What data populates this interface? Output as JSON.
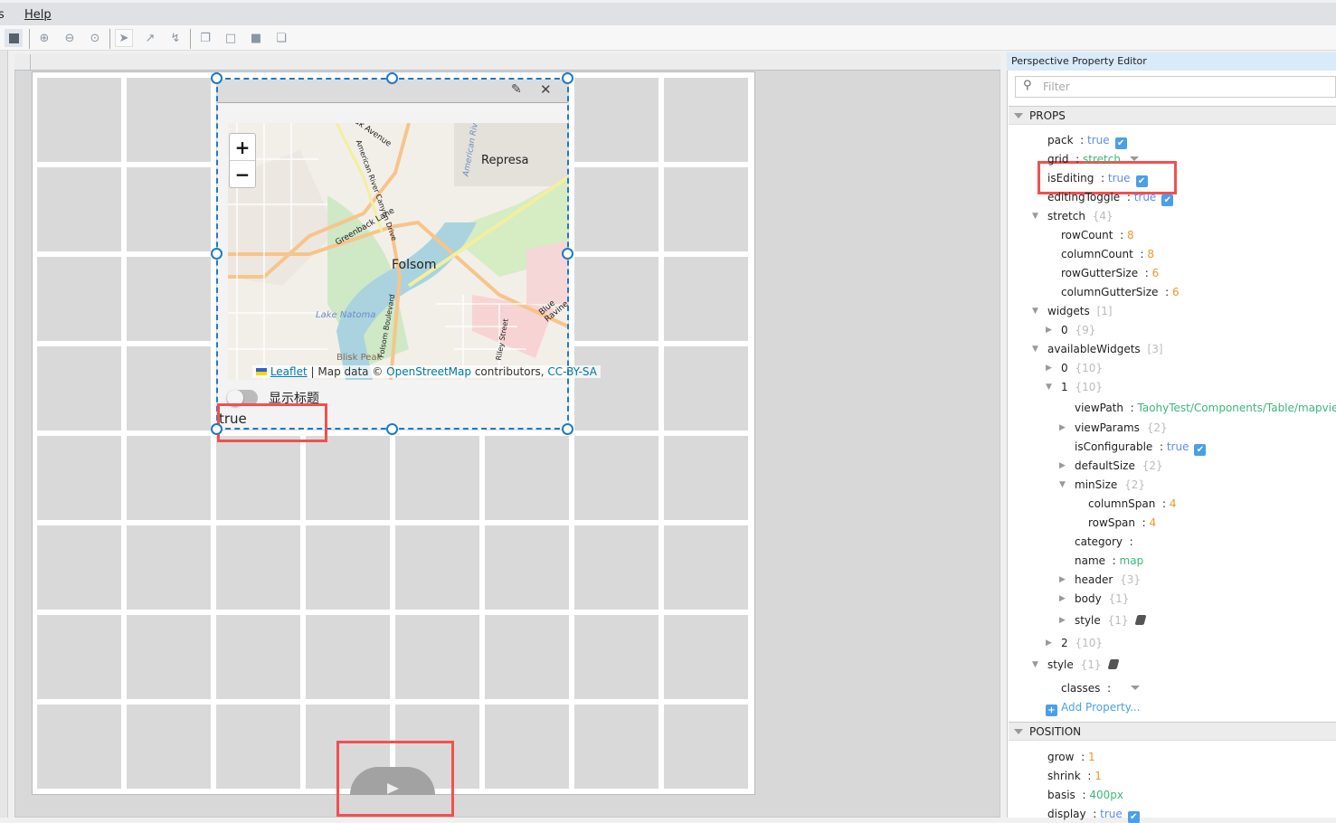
{
  "menubar": {
    "cut_item": "s",
    "help": "Help"
  },
  "toolbar": {
    "icons": [
      "stop-icon",
      "zoom-in-icon",
      "zoom-out-icon",
      "zoom-fit-icon",
      "select-arrow-icon",
      "connect-icon",
      "reroute-icon",
      "bring-front-icon",
      "send-back-icon",
      "group-icon",
      "layers-icon"
    ]
  },
  "widget": {
    "edit_icon": "pencil-icon",
    "close_icon": "close-icon",
    "map": {
      "zoom_in": "+",
      "zoom_out": "−",
      "labels": [
        "Represa",
        "Folsom",
        "Lake Natoma",
        "Blisk Peak",
        "Oak Avenue",
        "American River Canyon Drive",
        "Greenback Lane",
        "Folsom Boulevard",
        "Blue Ravine",
        "American River",
        "Riley Street"
      ],
      "attribution": {
        "leaflet": "Leaflet",
        "sep": " | Map data © ",
        "osm": "OpenStreetMap",
        "contrib": " contributors, ",
        "license": "CC-BY-SA"
      }
    },
    "toggle_label": "显示标题",
    "toggle_on": false,
    "value_text": "true"
  },
  "panel": {
    "title": "Perspective Property Editor",
    "filter_placeholder": "Filter",
    "props_header": "PROPS",
    "position_header": "POSITION",
    "add_property": "Add Property...",
    "props": [
      {
        "d": 0,
        "k": "pack",
        "v": "true",
        "t": "bool"
      },
      {
        "d": 0,
        "k": "grid",
        "v": "stretch",
        "t": "str",
        "dd": true
      },
      {
        "d": 0,
        "k": "isEditing",
        "v": "true",
        "t": "bool"
      },
      {
        "d": 0,
        "k": "editingToggle",
        "v": "true",
        "t": "bool"
      },
      {
        "d": 0,
        "k": "stretch",
        "v": "{4}",
        "t": "count",
        "exp": "open"
      },
      {
        "d": 1,
        "k": "rowCount",
        "v": "8",
        "t": "num"
      },
      {
        "d": 1,
        "k": "columnCount",
        "v": "8",
        "t": "num"
      },
      {
        "d": 1,
        "k": "rowGutterSize",
        "v": "6",
        "t": "num"
      },
      {
        "d": 1,
        "k": "columnGutterSize",
        "v": "6",
        "t": "num"
      },
      {
        "d": 0,
        "k": "widgets",
        "v": "[1]",
        "t": "count",
        "exp": "open"
      },
      {
        "d": 1,
        "k": "0",
        "v": "{9}",
        "t": "count",
        "exp": "closed"
      },
      {
        "d": 0,
        "k": "availableWidgets",
        "v": "[3]",
        "t": "count",
        "exp": "open"
      },
      {
        "d": 1,
        "k": "0",
        "v": "{10}",
        "t": "count",
        "exp": "closed"
      },
      {
        "d": 1,
        "k": "1",
        "v": "{10}",
        "t": "count",
        "exp": "open"
      },
      {
        "d": 2,
        "k": "viewPath",
        "v": "TaohyTest/Components/Table/mapview",
        "t": "str"
      },
      {
        "d": 2,
        "k": "viewParams",
        "v": "{2}",
        "t": "count",
        "exp": "closed"
      },
      {
        "d": 2,
        "k": "isConfigurable",
        "v": "true",
        "t": "bool"
      },
      {
        "d": 2,
        "k": "defaultSize",
        "v": "{2}",
        "t": "count",
        "exp": "closed"
      },
      {
        "d": 2,
        "k": "minSize",
        "v": "{2}",
        "t": "count",
        "exp": "open"
      },
      {
        "d": 3,
        "k": "columnSpan",
        "v": "4",
        "t": "num"
      },
      {
        "d": 3,
        "k": "rowSpan",
        "v": "4",
        "t": "num"
      },
      {
        "d": 2,
        "k": "category",
        "v": "",
        "t": "str"
      },
      {
        "d": 2,
        "k": "name",
        "v": "map",
        "t": "str"
      },
      {
        "d": 2,
        "k": "header",
        "v": "{3}",
        "t": "count",
        "exp": "closed"
      },
      {
        "d": 2,
        "k": "body",
        "v": "{1}",
        "t": "count",
        "exp": "closed"
      },
      {
        "d": 2,
        "k": "style",
        "v": "{1}",
        "t": "count",
        "exp": "closed",
        "brush": true
      },
      {
        "d": 1,
        "k": "2",
        "v": "{10}",
        "t": "count",
        "exp": "closed"
      },
      {
        "d": 0,
        "k": "style",
        "v": "{1}",
        "t": "count",
        "exp": "open",
        "brush": true
      },
      {
        "d": 1,
        "k": "classes",
        "v": "",
        "t": "str",
        "dd": true
      }
    ],
    "position": [
      {
        "d": 0,
        "k": "grow",
        "v": "1",
        "t": "num"
      },
      {
        "d": 0,
        "k": "shrink",
        "v": "1",
        "t": "num"
      },
      {
        "d": 0,
        "k": "basis",
        "v": "400px",
        "t": "str"
      },
      {
        "d": 0,
        "k": "display",
        "v": "true",
        "t": "bool"
      }
    ]
  },
  "colors": {
    "bool": "#5b8def",
    "num": "#f0962a",
    "str": "#3cb878",
    "selection": "#1f7ac4",
    "highlight": "#f25050"
  }
}
